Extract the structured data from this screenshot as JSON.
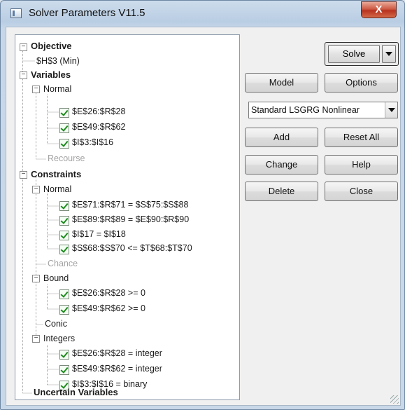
{
  "window": {
    "title": "Solver Parameters V11.5",
    "close_label": "X"
  },
  "tree": {
    "objective": {
      "label": "Objective",
      "cell": "$H$3 (Min)"
    },
    "variables": {
      "label": "Variables",
      "normal_label": "Normal",
      "normal_items": [
        "$E$26:$R$28",
        "$E$49:$R$62",
        "$I$3:$I$16"
      ],
      "recourse_label": "Recourse"
    },
    "constraints": {
      "label": "Constraints",
      "normal_label": "Normal",
      "normal_items": [
        "$E$71:$R$71 = $S$75:$S$88",
        "$E$89:$R$89 = $E$90:$R$90",
        "$I$17 = $I$18",
        "$S$68:$S$70 <= $T$68:$T$70"
      ],
      "chance_label": "Chance",
      "bound_label": "Bound",
      "bound_items": [
        "$E$26:$R$28 >= 0",
        "$E$49:$R$62 >= 0"
      ],
      "conic_label": "Conic",
      "integers_label": "Integers",
      "integers_items": [
        "$E$26:$R$28 = integer",
        "$E$49:$R$62 = integer",
        "$I$3:$I$16 = binary"
      ]
    },
    "uncertain_label": "Uncertain Variables"
  },
  "buttons": {
    "solve": "Solve",
    "model": "Model",
    "options": "Options",
    "add": "Add",
    "reset_all": "Reset All",
    "change": "Change",
    "help": "Help",
    "delete": "Delete",
    "close": "Close"
  },
  "engine": {
    "selected": "Standard LSGRG Nonlinear"
  }
}
